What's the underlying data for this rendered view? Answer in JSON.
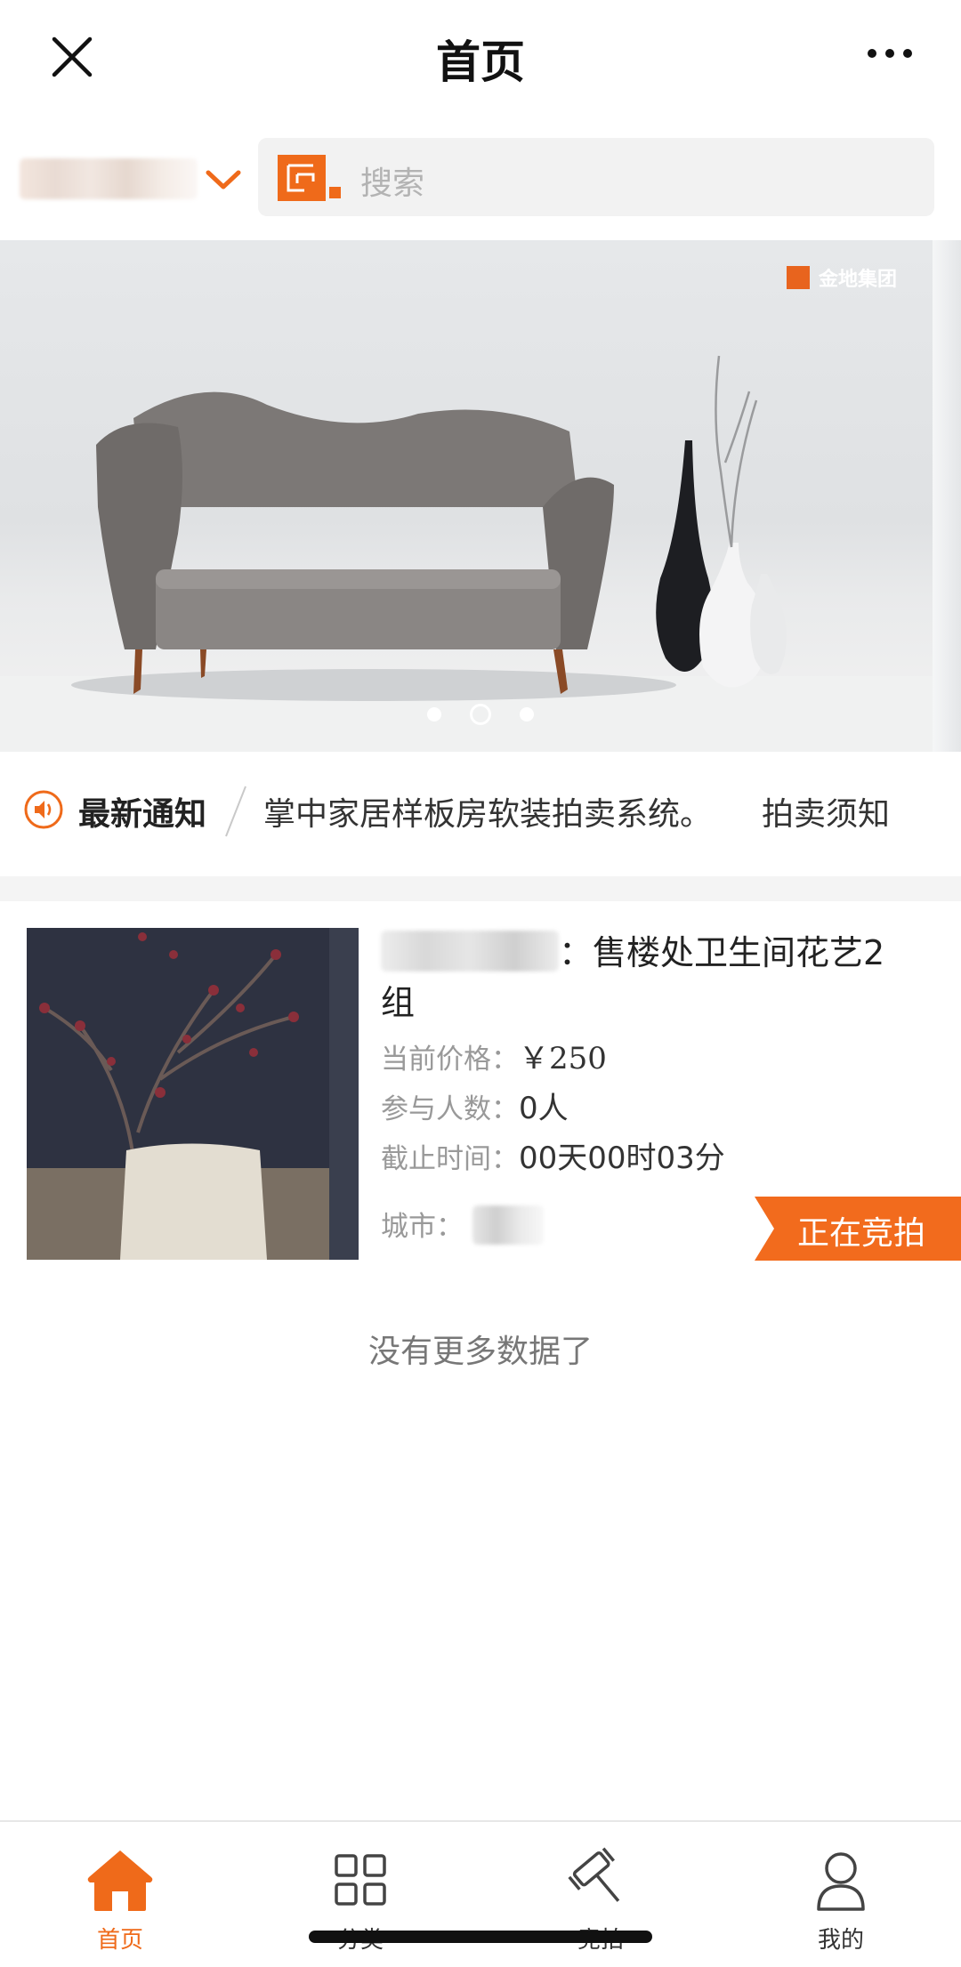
{
  "nav": {
    "title": "首页"
  },
  "search": {
    "placeholder": "搜索"
  },
  "banner": {
    "brand": "金地集团",
    "page_count": 3,
    "active_index": 1
  },
  "notice": {
    "label": "最新通知",
    "message": "掌中家居样板房软装拍卖系统。",
    "rules_link": "拍卖须知"
  },
  "item": {
    "title_suffix": "：售楼处卫生间花艺2",
    "title_line2": "组",
    "price_label": "当前价格：",
    "price_value": "￥250",
    "participants_label": "参与人数：",
    "participants_value": "0人",
    "deadline_label": "截止时间：",
    "deadline_value": "00天00时03分",
    "city_label": "城市：",
    "status": "正在竞拍"
  },
  "list_end": "没有更多数据了",
  "tabs": [
    {
      "label": "首页",
      "icon": "home-icon",
      "active": true
    },
    {
      "label": "分类",
      "icon": "grid-icon",
      "active": false
    },
    {
      "label": "竞拍",
      "icon": "gavel-icon",
      "active": false
    },
    {
      "label": "我的",
      "icon": "user-icon",
      "active": false
    }
  ],
  "colors": {
    "accent": "#f26b1d",
    "text": "#222222",
    "muted": "#999999"
  }
}
